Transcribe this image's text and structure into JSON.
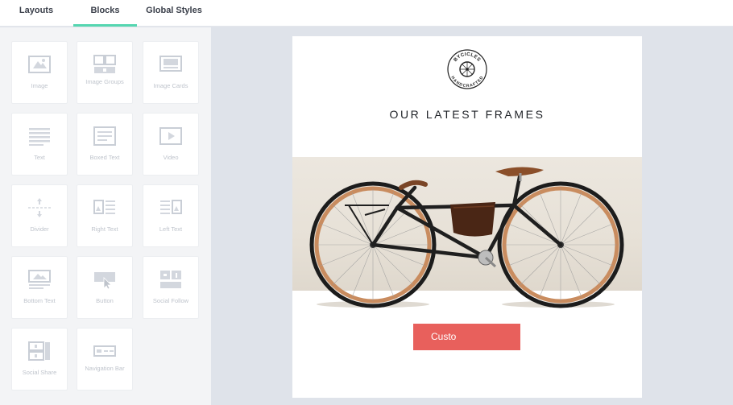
{
  "tabs": [
    {
      "label": "Layouts"
    },
    {
      "label": "Blocks"
    },
    {
      "label": "Global Styles"
    }
  ],
  "blocks": [
    {
      "label": "Image",
      "icon": "image-icon"
    },
    {
      "label": "Image Groups",
      "icon": "image-group-icon"
    },
    {
      "label": "Image Cards",
      "icon": "image-cards-icon"
    },
    {
      "label": "Text",
      "icon": "text-icon"
    },
    {
      "label": "Boxed Text",
      "icon": "boxed-text-icon"
    },
    {
      "label": "Video",
      "icon": "video-icon"
    },
    {
      "label": "Divider",
      "icon": "divider-icon"
    },
    {
      "label": "Right Text",
      "icon": "right-text-icon"
    },
    {
      "label": "Left Text",
      "icon": "left-text-icon"
    },
    {
      "label": "Bottom Text",
      "icon": "bottom-text-icon"
    },
    {
      "label": "Button",
      "icon": "button-icon"
    },
    {
      "label": "Social Follow",
      "icon": "social-follow-icon"
    },
    {
      "label": "Social Share",
      "icon": "social-share-icon"
    },
    {
      "label": "Navigation Bar",
      "icon": "navigation-bar-icon"
    }
  ],
  "email": {
    "logo_top": "BYCICLES",
    "logo_bottom": "HANDCRAFTED",
    "headline": "OUR LATEST FRAMES",
    "cta_label": "Custo"
  },
  "colors": {
    "accent": "#55d6b0",
    "cta": "#e8605c",
    "canvas": "#dfe3ea"
  }
}
